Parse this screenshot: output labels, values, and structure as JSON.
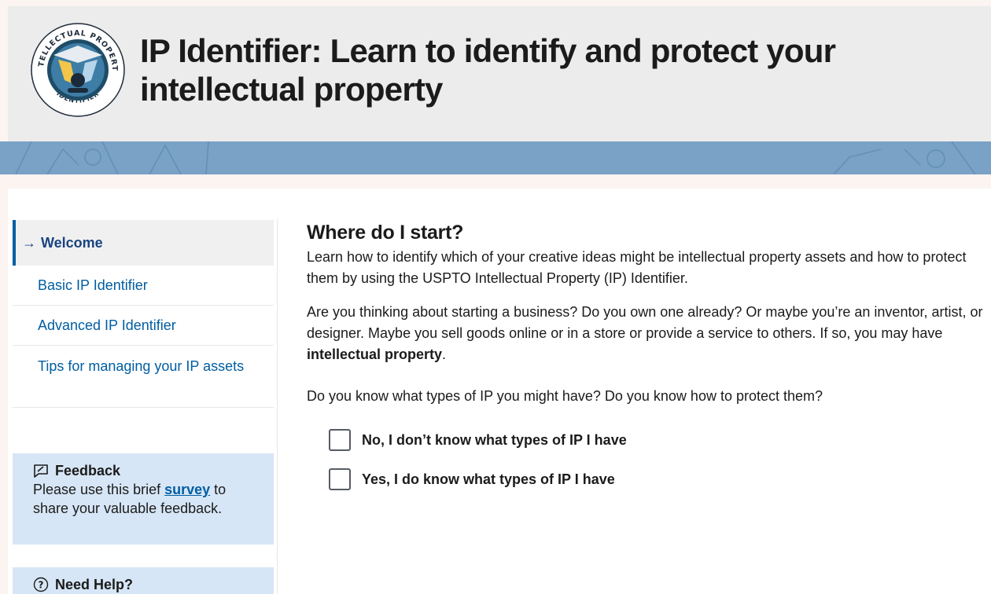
{
  "header": {
    "title": "IP Identifier: Learn to identify and protect your intellectual property",
    "logo": {
      "top_text": "INTELLECTUAL PROPERTY",
      "bottom_text": "IDENTIFIER",
      "icon": "ip-identifier-logo-icon"
    }
  },
  "sidebar": {
    "items": [
      {
        "label": "Welcome",
        "active": true,
        "icon": "arrow-right-icon"
      },
      {
        "label": "Basic IP Identifier"
      },
      {
        "label": "Advanced IP Identifier"
      },
      {
        "label": "Tips for managing your IP assets"
      }
    ],
    "feedback": {
      "title": "Feedback",
      "icon": "feedback-icon",
      "text_before": "Please use this brief",
      "link": "survey",
      "text_after": "to share your valuable feedback."
    },
    "help": {
      "title": "Need Help?",
      "icon": "question-circle-icon"
    }
  },
  "main": {
    "heading": "Where do I start?",
    "intro": "Learn how to identify which of your creative ideas might be intellectual property assets and how to protect them by using the USPTO Intellectual Property (IP) Identifier.",
    "para2_before": "Are you thinking about starting a business? Do you own one already? Or maybe you’re an inventor, artist, or designer. Maybe you sell goods online or in a store or provide a service to others. If so, you may have",
    "para2_bold": "intellectual property",
    "para2_after": ".",
    "question": "Do you know what types of IP you might have? Do you know how to protect them?",
    "options": [
      {
        "label": "No, I don’t know what types of IP I have",
        "checked": false
      },
      {
        "label": "Yes, I do know what types of IP I have",
        "checked": false
      }
    ]
  },
  "colors": {
    "banner": "#7aa1c6",
    "link": "#005ea2",
    "active_nav": "#1a4480",
    "info_box": "#d7e6f6",
    "header_bg": "#ececec"
  }
}
